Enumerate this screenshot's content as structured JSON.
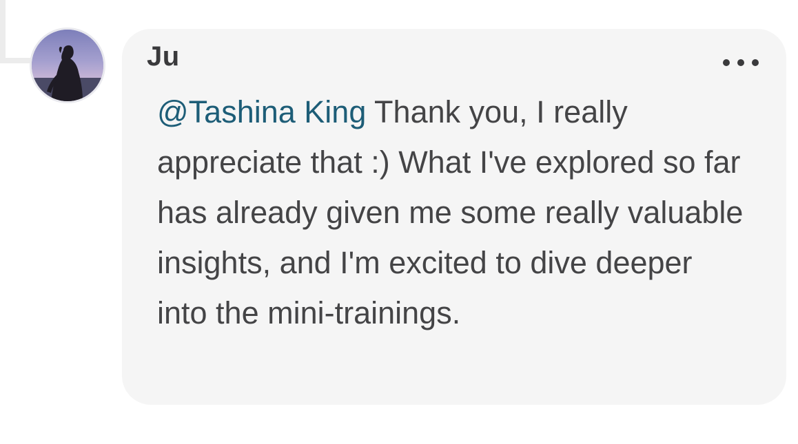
{
  "comment": {
    "author": "Ju",
    "mention": "@Tashina King",
    "body": " Thank you, I really appreciate that :) What I've explored so far has already given me some really valuable insights, and I'm excited to dive deeper into the mini-trainings."
  },
  "icons": {
    "avatar": "avatar-photo",
    "more": "more-options-icon"
  },
  "colors": {
    "bubble_background": "#f5f5f5",
    "mention": "#1d5d77",
    "text": "#444446"
  }
}
